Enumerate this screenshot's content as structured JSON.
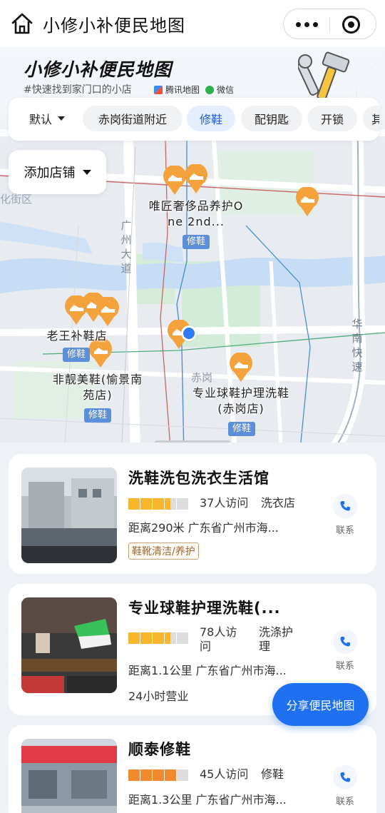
{
  "nav": {
    "title": "小修小补便民地图"
  },
  "header": {
    "app_title": "小修小补便民地图",
    "subtitle": "#快速找到家门口的小店",
    "brand_tencent": "腾讯地图",
    "brand_wechat": "微信"
  },
  "filters": {
    "default_label": "默认",
    "items": [
      "赤岗街道附近",
      "修鞋",
      "配钥匙",
      "开锁",
      "其"
    ],
    "active": "修鞋"
  },
  "add_shop": "添加店铺",
  "map": {
    "district": "化街区",
    "road_guangzhou": "广州大道",
    "road_huanan": "华南快速",
    "area_chigang": "赤岗",
    "shops": [
      {
        "name_l1": "唯匠奢侈品养护O",
        "name_l2": "ne 2nd...",
        "tag": "修鞋"
      },
      {
        "name_l1": "老王补鞋店",
        "tag": "修鞋"
      },
      {
        "name_l1": "非靓美鞋(愉景南",
        "name_l2": "苑店)",
        "tag": "修鞋"
      },
      {
        "name_l1": "专业球鞋护理洗鞋",
        "name_l2": "(赤岗店)",
        "tag": "修鞋"
      }
    ]
  },
  "list": [
    {
      "name": "洗鞋洗包洗衣生活馆",
      "rating": 3.5,
      "visits": "37人访问",
      "category": "洗衣店",
      "distance_address": "距离290米  广东省广州市海...",
      "badge": "鞋靴清洁/养护",
      "contact": "联系"
    },
    {
      "name": "专业球鞋护理洗鞋(...",
      "rating": 3.5,
      "visits_l1": "78人访",
      "visits_l2": "问",
      "category_l1": "洗涤护",
      "category_l2": "理",
      "distance_address": "距离1.1公里  广东省广州市海...",
      "hours": "24小时营业",
      "contact": "联系"
    },
    {
      "name": "顺泰修鞋",
      "rating": 4,
      "visits": "45人访问",
      "category": "修鞋",
      "distance_address": "距离1.3公里  广东省广州市海...",
      "contact": "联系"
    }
  ],
  "share_button": "分享便民地图",
  "colors": {
    "accent": "#1f6ff1",
    "pin": "#f4a23c",
    "star": "#f7b52c",
    "tag": "#5b8fd9"
  }
}
